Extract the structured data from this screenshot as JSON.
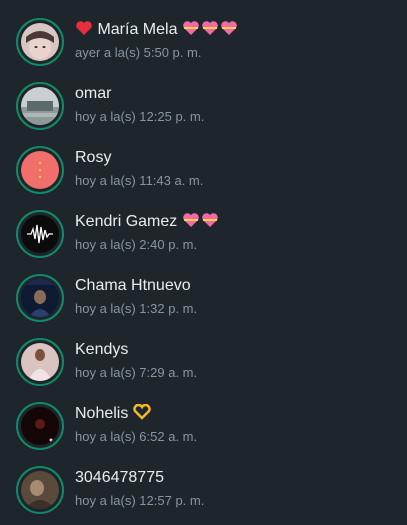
{
  "statuses": [
    {
      "name": "María Mela",
      "time": "ayer a la(s) 5:50 p. m."
    },
    {
      "name": "omar",
      "time": "hoy a la(s) 12:25 p. m."
    },
    {
      "name": "Rosy",
      "time": "hoy a la(s) 11:43 a. m."
    },
    {
      "name": "Kendri Gamez",
      "time": "hoy a la(s) 2:40 p. m."
    },
    {
      "name": "Chama Htnuevo",
      "time": "hoy a la(s) 1:32 p. m."
    },
    {
      "name": "Kendys",
      "time": "hoy a la(s) 7:29 a. m."
    },
    {
      "name": "Nohelis",
      "time": "hoy a la(s) 6:52 a. m."
    },
    {
      "name": "3046478775",
      "time": "hoy a la(s) 12:57 p. m."
    }
  ],
  "colors": {
    "background": "#1f262b",
    "ring": "#0f8a6a",
    "name_text": "#e9edef",
    "time_text": "#8696a0"
  },
  "icons": [
    "red-heart-emoji",
    "heart-with-ribbon-emoji",
    "heart-hands-emoji"
  ]
}
